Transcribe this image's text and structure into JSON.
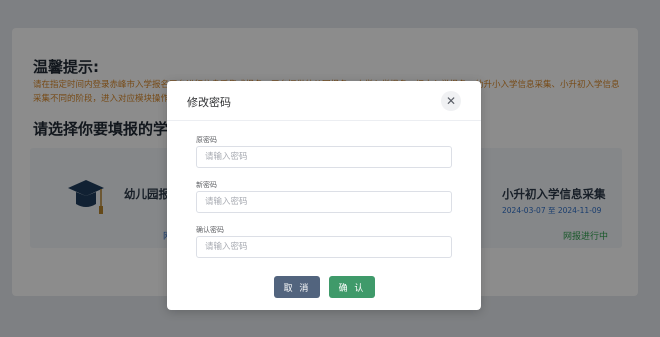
{
  "background": {
    "tips_title": "温馨提示:",
    "tips_text": "请在指定时间内登录赤峰市入学报名平台进行信息采集或报名，平台提供幼儿园报名、小学入学报名、初中入学报名、幼升小入学信息采集、小升初入学信息采集不同的阶段，进入对应模块操作。",
    "select_title": "请选择你要填报的学段",
    "options": [
      {
        "name": "幼儿园报名",
        "status": "网报进行中",
        "icon": "graduation-cap-icon"
      },
      {
        "name": "小升初入学信息采集",
        "date_range": "2024-03-07 至 2024-11-09",
        "status": "网报进行中",
        "icon": "graduation-cap-icon"
      }
    ]
  },
  "dialog": {
    "title": "修改密码",
    "close_icon": "close-icon",
    "fields": [
      {
        "label": "原密码",
        "placeholder": "请输入密码"
      },
      {
        "label": "新密码",
        "placeholder": "请输入密码"
      },
      {
        "label": "确认密码",
        "placeholder": "请输入密码"
      }
    ],
    "cancel_label": "取 消",
    "confirm_label": "确 认"
  },
  "colors": {
    "overlay": "rgba(0,0,0,0.45)",
    "cancel_button": "#52647e",
    "confirm_button": "#3f9a6a",
    "tips_text": "#d9892a",
    "status_active": "#2fa14e",
    "date_text": "#2f6fc8"
  }
}
